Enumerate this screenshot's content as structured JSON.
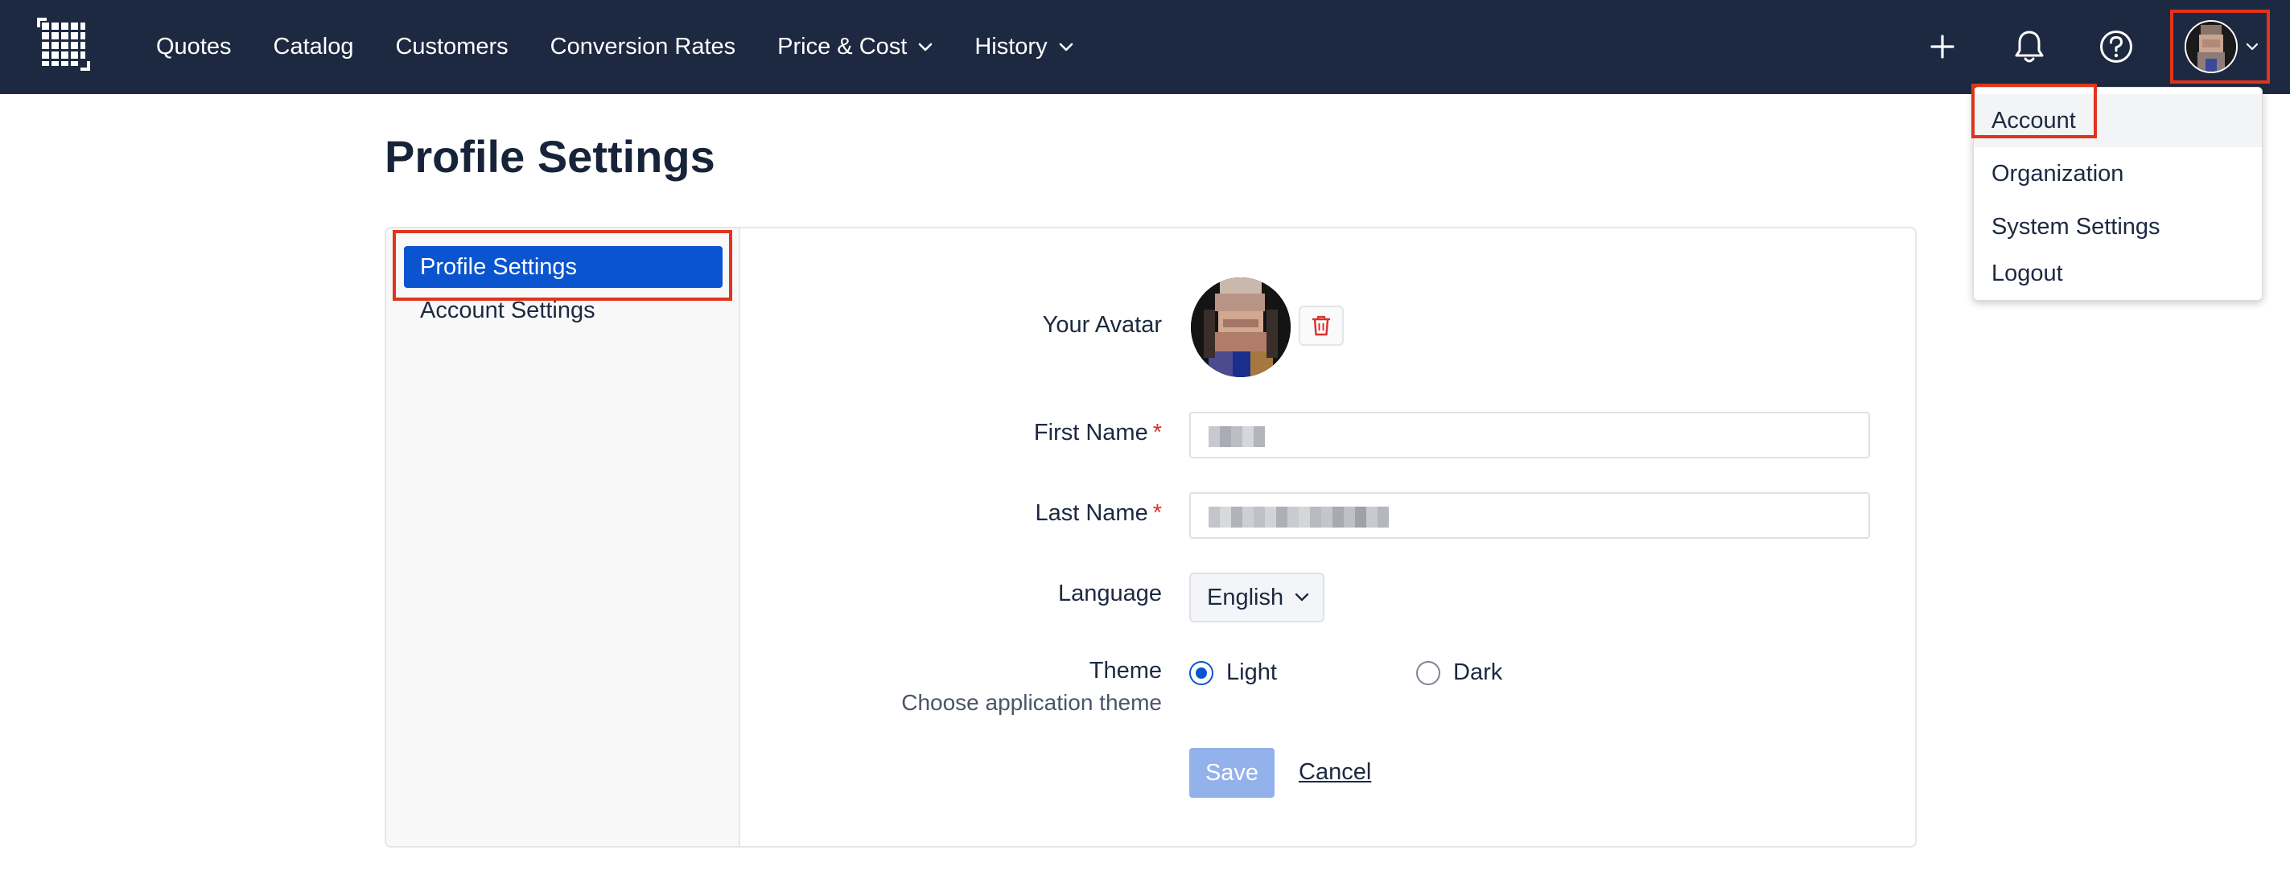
{
  "nav": {
    "logo_icon": "grid-logo-icon",
    "items": [
      {
        "label": "Quotes",
        "dropdown": false
      },
      {
        "label": "Catalog",
        "dropdown": false
      },
      {
        "label": "Customers",
        "dropdown": false
      },
      {
        "label": "Conversion Rates",
        "dropdown": false
      },
      {
        "label": "Price & Cost",
        "dropdown": true
      },
      {
        "label": "History",
        "dropdown": true
      }
    ],
    "icons": [
      "plus-icon",
      "bell-icon",
      "help-circle-icon"
    ]
  },
  "user_menu": {
    "items": [
      {
        "label": "Account",
        "active": true
      },
      {
        "label": "Organization",
        "active": false
      },
      {
        "label": "System Settings",
        "active": false
      },
      {
        "label": "Logout",
        "active": false
      }
    ]
  },
  "page": {
    "title": "Profile Settings"
  },
  "sidebar": {
    "items": [
      {
        "label": "Profile Settings",
        "active": true
      },
      {
        "label": "Account Settings",
        "active": false
      }
    ]
  },
  "form": {
    "avatar_label": "Your Avatar",
    "first_name_label": "First Name",
    "last_name_label": "Last Name",
    "required_mark": "*",
    "language_label": "Language",
    "language_value": "English",
    "theme_label": "Theme",
    "theme_sub": "Choose application theme",
    "theme_options": [
      {
        "label": "Light",
        "selected": true
      },
      {
        "label": "Dark",
        "selected": false
      }
    ],
    "save_label": "Save",
    "cancel_label": "Cancel"
  },
  "colors": {
    "nav_bg": "#1c2940",
    "primary": "#0a55cf",
    "highlight": "#e0341c",
    "required": "#d9302c",
    "save_disabled": "#93b1eb"
  }
}
